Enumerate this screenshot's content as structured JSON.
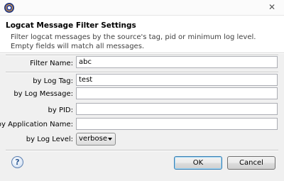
{
  "dialog": {
    "window_title": "",
    "header_title": "Logcat Message Filter Settings",
    "header_message_line1": "Filter logcat messages by the source's tag, pid or minimum log level.",
    "header_message_line2": "Empty fields will match all messages."
  },
  "form": {
    "filter_name": {
      "label": "Filter Name:",
      "value": "abc"
    },
    "log_tag": {
      "label": "by Log Tag:",
      "value": "test"
    },
    "log_message": {
      "label": "by Log Message:",
      "value": ""
    },
    "pid": {
      "label": "by PID:",
      "value": ""
    },
    "application_name": {
      "label": "by Application Name:",
      "value": ""
    },
    "log_level": {
      "label": "by Log Level:",
      "selected": "verbose"
    }
  },
  "buttons": {
    "ok_label": "OK",
    "cancel_label": "Cancel",
    "help_label": "?"
  },
  "icons": {
    "app": "eclipse-icon",
    "close": "close-icon",
    "help": "help-icon",
    "dropdown": "chevron-down-icon"
  }
}
